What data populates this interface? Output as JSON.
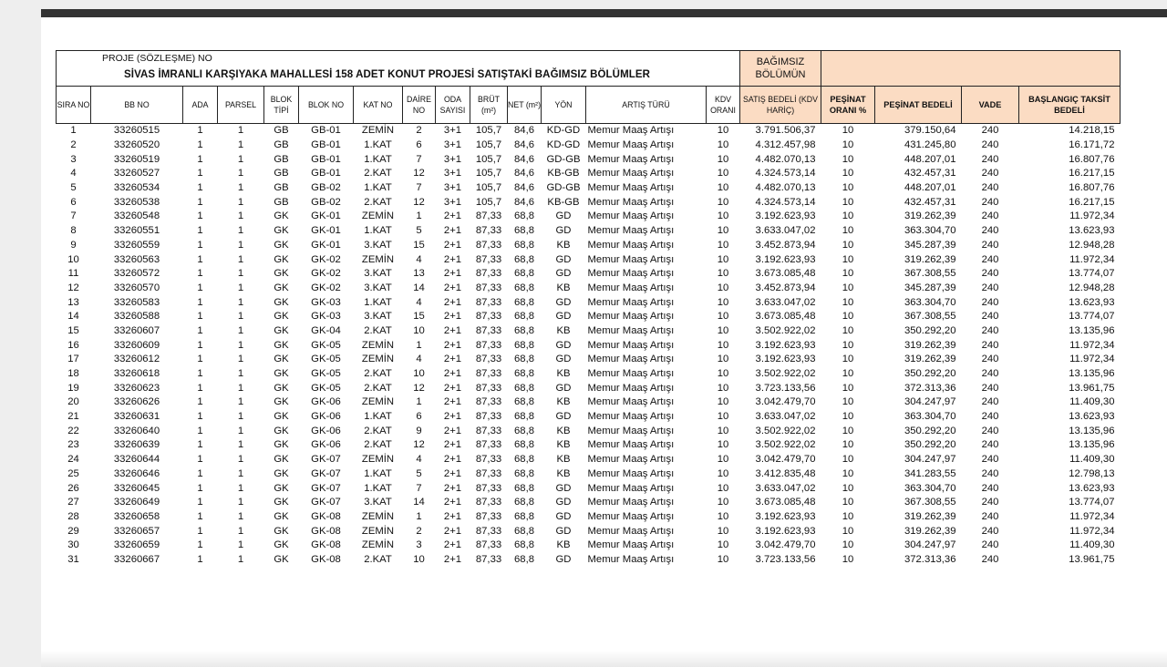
{
  "document": {
    "project_no_label": "PROJE (SÖZLEŞME) NO",
    "title": "SİVAS İMRANLI KARŞIYAKA MAHALLESİ 158 ADET KONUT PROJESİ SATIŞTAKİ BAĞIMSIZ BÖLÜMLER",
    "bb_header": "BAĞIMSIZ BÖLÜMÜN",
    "columns": {
      "sira": "SIRA NO",
      "bb_no": "BB NO",
      "ada": "ADA",
      "parsel": "PARSEL",
      "blok_tipi": "BLOK TİPİ",
      "blok_no": "BLOK NO",
      "kat_no": "KAT NO",
      "daire_no": "DAİRE NO",
      "oda": "ODA SAYISI",
      "brut": "BRÜT (m²)",
      "net": "NET (m²)",
      "yon": "YÖN",
      "artis": "ARTIŞ TÜRÜ",
      "kdv": "KDV ORANI",
      "satis": "SATIŞ BEDELİ (KDV HARİÇ)",
      "pesinat_orani": "PEŞİNAT ORANI %",
      "pesinat_bedeli": "PEŞİNAT BEDELİ",
      "vade": "VADE",
      "taksit": "BAŞLANGIÇ TAKSİT BEDELİ"
    },
    "rows": [
      [
        "1",
        "33260515",
        "1",
        "1",
        "GB",
        "GB-01",
        "ZEMİN",
        "2",
        "3+1",
        "105,7",
        "84,6",
        "KD-GD",
        "Memur Maaş Artışı",
        "10",
        "3.791.506,37",
        "10",
        "379.150,64",
        "240",
        "14.218,15"
      ],
      [
        "2",
        "33260520",
        "1",
        "1",
        "GB",
        "GB-01",
        "1.KAT",
        "6",
        "3+1",
        "105,7",
        "84,6",
        "KD-GD",
        "Memur Maaş Artışı",
        "10",
        "4.312.457,98",
        "10",
        "431.245,80",
        "240",
        "16.171,72"
      ],
      [
        "3",
        "33260519",
        "1",
        "1",
        "GB",
        "GB-01",
        "1.KAT",
        "7",
        "3+1",
        "105,7",
        "84,6",
        "GD-GB",
        "Memur Maaş Artışı",
        "10",
        "4.482.070,13",
        "10",
        "448.207,01",
        "240",
        "16.807,76"
      ],
      [
        "4",
        "33260527",
        "1",
        "1",
        "GB",
        "GB-01",
        "2.KAT",
        "12",
        "3+1",
        "105,7",
        "84,6",
        "KB-GB",
        "Memur Maaş Artışı",
        "10",
        "4.324.573,14",
        "10",
        "432.457,31",
        "240",
        "16.217,15"
      ],
      [
        "5",
        "33260534",
        "1",
        "1",
        "GB",
        "GB-02",
        "1.KAT",
        "7",
        "3+1",
        "105,7",
        "84,6",
        "GD-GB",
        "Memur Maaş Artışı",
        "10",
        "4.482.070,13",
        "10",
        "448.207,01",
        "240",
        "16.807,76"
      ],
      [
        "6",
        "33260538",
        "1",
        "1",
        "GB",
        "GB-02",
        "2.KAT",
        "12",
        "3+1",
        "105,7",
        "84,6",
        "KB-GB",
        "Memur Maaş Artışı",
        "10",
        "4.324.573,14",
        "10",
        "432.457,31",
        "240",
        "16.217,15"
      ],
      [
        "7",
        "33260548",
        "1",
        "1",
        "GK",
        "GK-01",
        "ZEMİN",
        "1",
        "2+1",
        "87,33",
        "68,8",
        "GD",
        "Memur Maaş Artışı",
        "10",
        "3.192.623,93",
        "10",
        "319.262,39",
        "240",
        "11.972,34"
      ],
      [
        "8",
        "33260551",
        "1",
        "1",
        "GK",
        "GK-01",
        "1.KAT",
        "5",
        "2+1",
        "87,33",
        "68,8",
        "GD",
        "Memur Maaş Artışı",
        "10",
        "3.633.047,02",
        "10",
        "363.304,70",
        "240",
        "13.623,93"
      ],
      [
        "9",
        "33260559",
        "1",
        "1",
        "GK",
        "GK-01",
        "3.KAT",
        "15",
        "2+1",
        "87,33",
        "68,8",
        "KB",
        "Memur Maaş Artışı",
        "10",
        "3.452.873,94",
        "10",
        "345.287,39",
        "240",
        "12.948,28"
      ],
      [
        "10",
        "33260563",
        "1",
        "1",
        "GK",
        "GK-02",
        "ZEMİN",
        "4",
        "2+1",
        "87,33",
        "68,8",
        "GD",
        "Memur Maaş Artışı",
        "10",
        "3.192.623,93",
        "10",
        "319.262,39",
        "240",
        "11.972,34"
      ],
      [
        "11",
        "33260572",
        "1",
        "1",
        "GK",
        "GK-02",
        "3.KAT",
        "13",
        "2+1",
        "87,33",
        "68,8",
        "GD",
        "Memur Maaş Artışı",
        "10",
        "3.673.085,48",
        "10",
        "367.308,55",
        "240",
        "13.774,07"
      ],
      [
        "12",
        "33260570",
        "1",
        "1",
        "GK",
        "GK-02",
        "3.KAT",
        "14",
        "2+1",
        "87,33",
        "68,8",
        "KB",
        "Memur Maaş Artışı",
        "10",
        "3.452.873,94",
        "10",
        "345.287,39",
        "240",
        "12.948,28"
      ],
      [
        "13",
        "33260583",
        "1",
        "1",
        "GK",
        "GK-03",
        "1.KAT",
        "4",
        "2+1",
        "87,33",
        "68,8",
        "GD",
        "Memur Maaş Artışı",
        "10",
        "3.633.047,02",
        "10",
        "363.304,70",
        "240",
        "13.623,93"
      ],
      [
        "14",
        "33260588",
        "1",
        "1",
        "GK",
        "GK-03",
        "3.KAT",
        "15",
        "2+1",
        "87,33",
        "68,8",
        "GD",
        "Memur Maaş Artışı",
        "10",
        "3.673.085,48",
        "10",
        "367.308,55",
        "240",
        "13.774,07"
      ],
      [
        "15",
        "33260607",
        "1",
        "1",
        "GK",
        "GK-04",
        "2.KAT",
        "10",
        "2+1",
        "87,33",
        "68,8",
        "KB",
        "Memur Maaş Artışı",
        "10",
        "3.502.922,02",
        "10",
        "350.292,20",
        "240",
        "13.135,96"
      ],
      [
        "16",
        "33260609",
        "1",
        "1",
        "GK",
        "GK-05",
        "ZEMİN",
        "1",
        "2+1",
        "87,33",
        "68,8",
        "GD",
        "Memur Maaş Artışı",
        "10",
        "3.192.623,93",
        "10",
        "319.262,39",
        "240",
        "11.972,34"
      ],
      [
        "17",
        "33260612",
        "1",
        "1",
        "GK",
        "GK-05",
        "ZEMİN",
        "4",
        "2+1",
        "87,33",
        "68,8",
        "GD",
        "Memur Maaş Artışı",
        "10",
        "3.192.623,93",
        "10",
        "319.262,39",
        "240",
        "11.972,34"
      ],
      [
        "18",
        "33260618",
        "1",
        "1",
        "GK",
        "GK-05",
        "2.KAT",
        "10",
        "2+1",
        "87,33",
        "68,8",
        "KB",
        "Memur Maaş Artışı",
        "10",
        "3.502.922,02",
        "10",
        "350.292,20",
        "240",
        "13.135,96"
      ],
      [
        "19",
        "33260623",
        "1",
        "1",
        "GK",
        "GK-05",
        "2.KAT",
        "12",
        "2+1",
        "87,33",
        "68,8",
        "GD",
        "Memur Maaş Artışı",
        "10",
        "3.723.133,56",
        "10",
        "372.313,36",
        "240",
        "13.961,75"
      ],
      [
        "20",
        "33260626",
        "1",
        "1",
        "GK",
        "GK-06",
        "ZEMİN",
        "1",
        "2+1",
        "87,33",
        "68,8",
        "KB",
        "Memur Maaş Artışı",
        "10",
        "3.042.479,70",
        "10",
        "304.247,97",
        "240",
        "11.409,30"
      ],
      [
        "21",
        "33260631",
        "1",
        "1",
        "GK",
        "GK-06",
        "1.KAT",
        "6",
        "2+1",
        "87,33",
        "68,8",
        "GD",
        "Memur Maaş Artışı",
        "10",
        "3.633.047,02",
        "10",
        "363.304,70",
        "240",
        "13.623,93"
      ],
      [
        "22",
        "33260640",
        "1",
        "1",
        "GK",
        "GK-06",
        "2.KAT",
        "9",
        "2+1",
        "87,33",
        "68,8",
        "KB",
        "Memur Maaş Artışı",
        "10",
        "3.502.922,02",
        "10",
        "350.292,20",
        "240",
        "13.135,96"
      ],
      [
        "23",
        "33260639",
        "1",
        "1",
        "GK",
        "GK-06",
        "2.KAT",
        "12",
        "2+1",
        "87,33",
        "68,8",
        "KB",
        "Memur Maaş Artışı",
        "10",
        "3.502.922,02",
        "10",
        "350.292,20",
        "240",
        "13.135,96"
      ],
      [
        "24",
        "33260644",
        "1",
        "1",
        "GK",
        "GK-07",
        "ZEMİN",
        "4",
        "2+1",
        "87,33",
        "68,8",
        "KB",
        "Memur Maaş Artışı",
        "10",
        "3.042.479,70",
        "10",
        "304.247,97",
        "240",
        "11.409,30"
      ],
      [
        "25",
        "33260646",
        "1",
        "1",
        "GK",
        "GK-07",
        "1.KAT",
        "5",
        "2+1",
        "87,33",
        "68,8",
        "KB",
        "Memur Maaş Artışı",
        "10",
        "3.412.835,48",
        "10",
        "341.283,55",
        "240",
        "12.798,13"
      ],
      [
        "26",
        "33260645",
        "1",
        "1",
        "GK",
        "GK-07",
        "1.KAT",
        "7",
        "2+1",
        "87,33",
        "68,8",
        "GD",
        "Memur Maaş Artışı",
        "10",
        "3.633.047,02",
        "10",
        "363.304,70",
        "240",
        "13.623,93"
      ],
      [
        "27",
        "33260649",
        "1",
        "1",
        "GK",
        "GK-07",
        "3.KAT",
        "14",
        "2+1",
        "87,33",
        "68,8",
        "GD",
        "Memur Maaş Artışı",
        "10",
        "3.673.085,48",
        "10",
        "367.308,55",
        "240",
        "13.774,07"
      ],
      [
        "28",
        "33260658",
        "1",
        "1",
        "GK",
        "GK-08",
        "ZEMİN",
        "1",
        "2+1",
        "87,33",
        "68,8",
        "GD",
        "Memur Maaş Artışı",
        "10",
        "3.192.623,93",
        "10",
        "319.262,39",
        "240",
        "11.972,34"
      ],
      [
        "29",
        "33260657",
        "1",
        "1",
        "GK",
        "GK-08",
        "ZEMİN",
        "2",
        "2+1",
        "87,33",
        "68,8",
        "GD",
        "Memur Maaş Artışı",
        "10",
        "3.192.623,93",
        "10",
        "319.262,39",
        "240",
        "11.972,34"
      ],
      [
        "30",
        "33260659",
        "1",
        "1",
        "GK",
        "GK-08",
        "ZEMİN",
        "3",
        "2+1",
        "87,33",
        "68,8",
        "KB",
        "Memur Maaş Artışı",
        "10",
        "3.042.479,70",
        "10",
        "304.247,97",
        "240",
        "11.409,30"
      ],
      [
        "31",
        "33260667",
        "1",
        "1",
        "GK",
        "GK-08",
        "2.KAT",
        "10",
        "2+1",
        "87,33",
        "68,8",
        "GD",
        "Memur Maaş Artışı",
        "10",
        "3.723.133,56",
        "10",
        "372.313,36",
        "240",
        "13.961,75"
      ]
    ]
  },
  "colors": {
    "header_fill": "#fbdcc3",
    "toolbar": "#333333",
    "background": "#eeeeee"
  }
}
